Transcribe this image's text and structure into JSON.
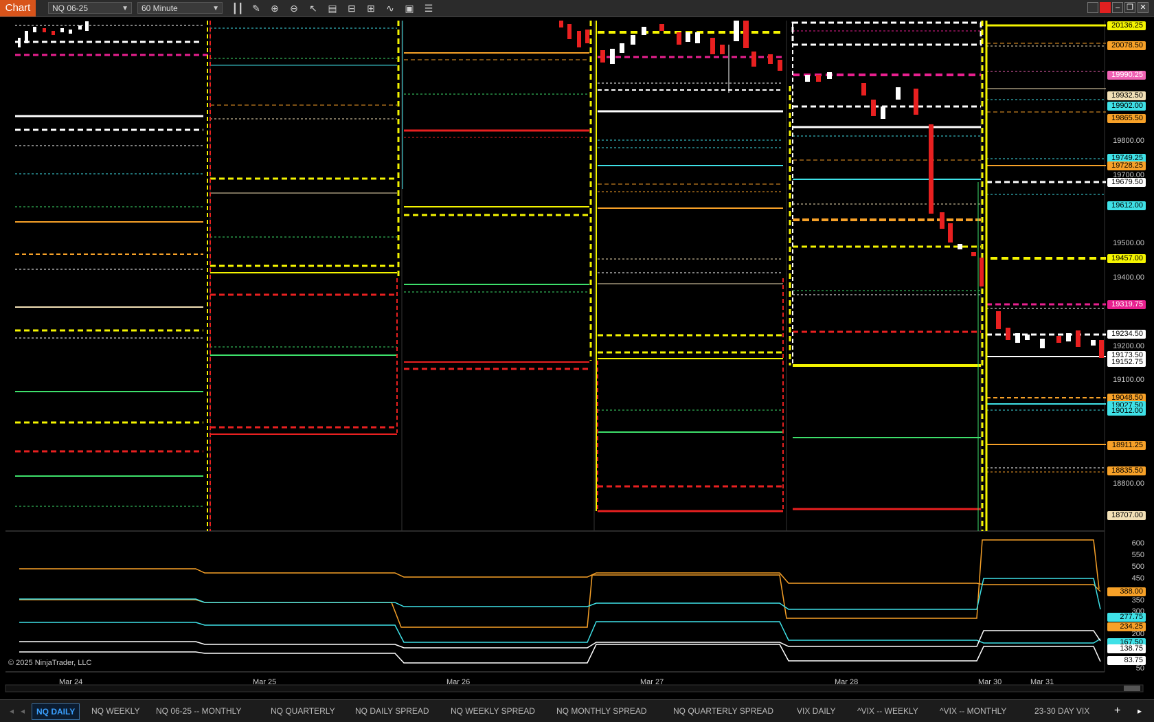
{
  "window": {
    "tab_label": "Chart"
  },
  "toolbar": {
    "instrument": "NQ 06-25",
    "timeframe": "60 Minute",
    "icons": [
      "bar-type-icon",
      "draw-pencil-icon",
      "zoom-in-icon",
      "zoom-out-icon",
      "pointer-icon",
      "data-box-icon",
      "templates-icon",
      "properties-icon",
      "indicators-icon",
      "strategies-icon",
      "list-icon"
    ]
  },
  "window_controls": [
    "restore-icon",
    "maximize-icon",
    "minimize-icon",
    "pop-out-icon",
    "close-icon"
  ],
  "price_axis": {
    "ticks": [
      "19800.00",
      "19700.00",
      "19500.00",
      "19400.00",
      "19200.00",
      "19100.00",
      "18800.00"
    ],
    "labels": [
      {
        "text": "20136.25",
        "color": "#f4f400"
      },
      {
        "text": "20078.50",
        "color": "#f7a128"
      },
      {
        "text": "19990.25",
        "color": "#f062b4"
      },
      {
        "text": "19932.50",
        "color": "#f2e0b6"
      },
      {
        "text": "19902.00",
        "color": "#3fe1e7"
      },
      {
        "text": "19865.50",
        "color": "#f7a128"
      },
      {
        "text": "19749.25",
        "color": "#3fe1e7"
      },
      {
        "text": "19728.25",
        "color": "#f7a128"
      },
      {
        "text": "19679.50",
        "color": "#ffffff"
      },
      {
        "text": "19612.00",
        "color": "#3fe1e7"
      },
      {
        "text": "19457.00",
        "color": "#f4f400"
      },
      {
        "text": "19319.75",
        "color": "#e8208f"
      },
      {
        "text": "19234.50",
        "color": "#ffffff"
      },
      {
        "text": "19173.50",
        "color": "#ffffff"
      },
      {
        "text": "19152.75",
        "color": "#ffffff"
      },
      {
        "text": "19048.50",
        "color": "#f7a128"
      },
      {
        "text": "19027.50",
        "color": "#3fe1e7"
      },
      {
        "text": "19012.00",
        "color": "#3fe1e7"
      },
      {
        "text": "18911.25",
        "color": "#f7a128"
      },
      {
        "text": "18835.50",
        "color": "#f7a128"
      },
      {
        "text": "18707.00",
        "color": "#f2e0b6"
      }
    ]
  },
  "lower_panel": {
    "ticks": [
      "600",
      "550",
      "500",
      "450",
      "350",
      "300",
      "200",
      "50"
    ],
    "labels": [
      {
        "text": "388.00",
        "color": "#f7a128"
      },
      {
        "text": "277.75",
        "color": "#3fe1e7"
      },
      {
        "text": "234.25",
        "color": "#f7a128"
      },
      {
        "text": "167.50",
        "color": "#3fe1e7"
      },
      {
        "text": "138.75",
        "color": "#ffffff"
      },
      {
        "text": "83.75",
        "color": "#ffffff"
      }
    ]
  },
  "dates": [
    "Mar 24",
    "Mar 25",
    "Mar 26",
    "Mar 27",
    "Mar 28",
    "Mar 30",
    "Mar 31"
  ],
  "copyright": "© 2025 NinjaTrader, LLC",
  "bottom_tabs": [
    {
      "label": "NQ DAILY",
      "active": true
    },
    {
      "label": "NQ WEEKLY"
    },
    {
      "label": "NQ 06-25 -- MONTHLY"
    },
    {
      "label": "NQ QUARTERLY"
    },
    {
      "label": "NQ DAILY SPREAD"
    },
    {
      "label": "NQ WEEKLY SPREAD"
    },
    {
      "label": "NQ MONTHLY SPREAD"
    },
    {
      "label": "NQ QUARTERLY SPREAD"
    },
    {
      "label": "VIX DAILY"
    },
    {
      "label": "^VIX -- WEEKLY"
    },
    {
      "label": "^VIX -- MONTHLY"
    },
    {
      "label": "23-30 DAY VIX"
    }
  ]
}
